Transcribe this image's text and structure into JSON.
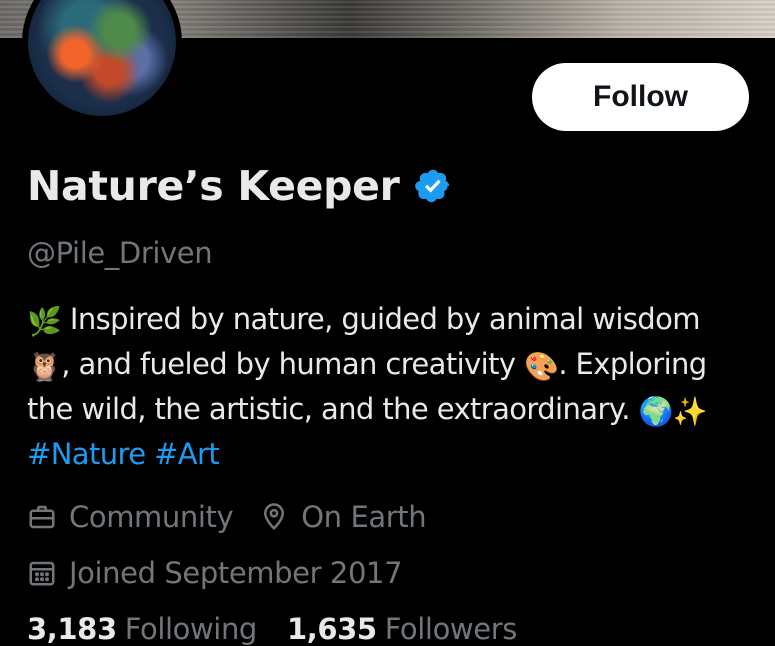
{
  "profile": {
    "display_name": "Nature’s Keeper",
    "handle": "@Pile_Driven",
    "verified_icon": "verified-badge-icon",
    "follow_label": "Follow"
  },
  "bio": {
    "line1_emoji": "🌿",
    "line1_text": " Inspired by nature, guided by animal wisdom",
    "line2_emoji": "🦉",
    "line2_text": ", and fueled by human creativity ",
    "line2_emoji2": "🎨",
    "line2_text2": ". Exploring",
    "line3_text": "the wild, the artistic, and the extraordinary. ",
    "line3_emoji": "🌍",
    "line3_emoji2": "✨",
    "hashtags": [
      "#Nature",
      "#Art"
    ]
  },
  "meta": {
    "category": "Community",
    "category_icon": "briefcase-icon",
    "location": "On Earth",
    "location_icon": "location-pin-icon",
    "joined": "Joined September 2017",
    "joined_icon": "calendar-icon"
  },
  "stats": {
    "following_count": "3,183",
    "following_label": "Following",
    "followers_count": "1,635",
    "followers_label": "Followers"
  },
  "colors": {
    "background": "#000000",
    "text_primary": "#e7e9ea",
    "text_secondary": "#71767b",
    "accent": "#1d9bf0"
  }
}
